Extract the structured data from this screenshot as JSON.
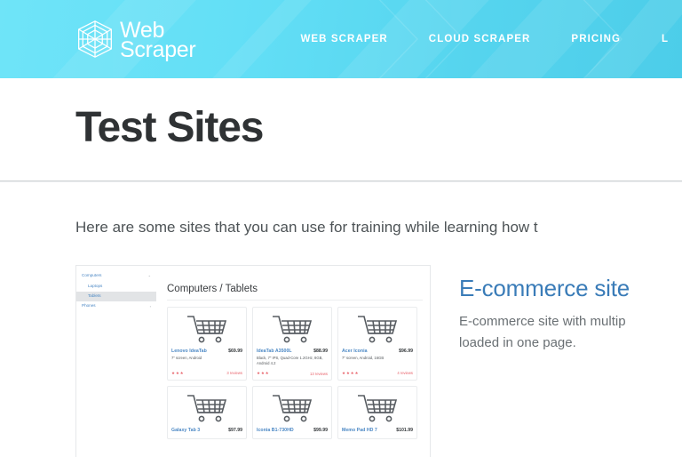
{
  "header": {
    "logo": {
      "icon": "hexagon-web-icon",
      "line1": "Web",
      "line2": "Scraper"
    },
    "nav": [
      {
        "label": "WEB SCRAPER",
        "name": "nav-web-scraper"
      },
      {
        "label": "CLOUD SCRAPER",
        "name": "nav-cloud-scraper"
      },
      {
        "label": "PRICING",
        "name": "nav-pricing"
      },
      {
        "label": "L",
        "name": "nav-learn-truncated"
      }
    ],
    "colors": {
      "gradient_start": "#6fe4f8",
      "gradient_end": "#4ccde9",
      "text": "#ffffff"
    }
  },
  "main": {
    "title": "Test Sites",
    "intro": "Here are some sites that you can use for training while learning how t",
    "site": {
      "title": "E-commerce site",
      "title_color": "#3a7cb8",
      "description_line1": "E-commerce site with multip",
      "description_line2": "loaded in one page."
    }
  },
  "preview": {
    "sidebar": [
      {
        "label": "Computers",
        "caret": "⌄",
        "sub": false,
        "active": false
      },
      {
        "label": "Laptops",
        "caret": "",
        "sub": true,
        "active": false
      },
      {
        "label": "Tablets",
        "caret": "",
        "sub": true,
        "active": true
      },
      {
        "label": "Phones",
        "caret": "›",
        "sub": false,
        "active": false
      }
    ],
    "heading": "Computers / Tablets",
    "products": [
      {
        "name": "Lenovo IdeaTab",
        "price": "$69.99",
        "desc": "7\" screen, Android",
        "stars": "★★★",
        "reviews": "3 reviews"
      },
      {
        "name": "IdeaTab A3500L",
        "price": "$88.99",
        "desc": "Black, 7\" IPS, Quad-Core 1.2GHz, 8GB, Android 4.2",
        "stars": "★★★",
        "reviews": "13 reviews"
      },
      {
        "name": "Acer Iconia",
        "price": "$96.99",
        "desc": "7\" screen, Android, 16GB",
        "stars": "★★★★",
        "reviews": "4 reviews"
      },
      {
        "name": "Galaxy Tab 3",
        "price": "$97.99",
        "desc": "",
        "stars": "",
        "reviews": ""
      },
      {
        "name": "Iconia B1-730HD",
        "price": "$99.99",
        "desc": "",
        "stars": "",
        "reviews": ""
      },
      {
        "name": "Memo Pad HD 7",
        "price": "$101.99",
        "desc": "",
        "stars": "",
        "reviews": ""
      }
    ]
  }
}
